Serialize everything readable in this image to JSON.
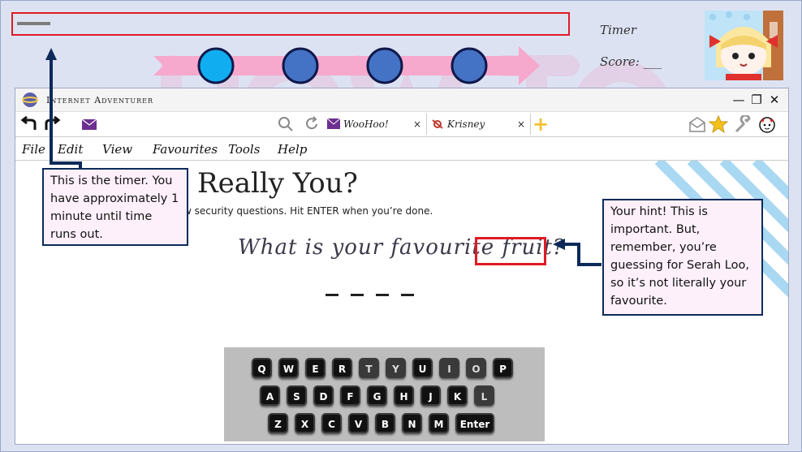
{
  "hud": {
    "timer_label": "Timer",
    "score_label": "Score: ___",
    "timer_fill_fraction": 0.06,
    "progress_steps": 4,
    "progress_current": 1
  },
  "browser": {
    "title": "Internet Adventurer",
    "tabs": [
      {
        "label": "WooHoo!",
        "icon": "mail-icon"
      },
      {
        "label": "Krisney",
        "icon": "krisney-icon"
      }
    ],
    "tab_close": "×",
    "new_tab": "+",
    "menu": [
      "File",
      "Edit",
      "View",
      "Favourites",
      "Tools",
      "Help"
    ],
    "window_controls": {
      "minimize": "—",
      "maximize": "❐",
      "close": "✕"
    }
  },
  "page": {
    "heading": "Really You?",
    "instructions": "w security questions. Hit ENTER when you’re done.",
    "question": "What is your favourite fruit?",
    "answer_blank_count": 4
  },
  "keyboard": {
    "rows": [
      [
        "Q",
        "W",
        "E",
        "R",
        "T",
        "Y",
        "U",
        "I",
        "O",
        "P"
      ],
      [
        "A",
        "S",
        "D",
        "F",
        "G",
        "H",
        "J",
        "K",
        "L"
      ],
      [
        "Z",
        "X",
        "C",
        "V",
        "B",
        "N",
        "M",
        "Enter"
      ]
    ],
    "disabled_keys": [
      "T",
      "Y",
      "I",
      "O",
      "L"
    ]
  },
  "callouts": {
    "timer": "This is the timer. You have approximately 1 minute until time runs out.",
    "hint": "Your hint! This is important. But, remember, you’re guessing for Serah Loo, so it’s not literally your favourite."
  },
  "colors": {
    "highlight": "#e01b24",
    "callout_border": "#0b2a5a",
    "callout_bg": "#fdf0fb",
    "progress_arrow": "#f7a8cd",
    "progress_active": "#10aef0",
    "progress_inactive": "#4473c5"
  }
}
